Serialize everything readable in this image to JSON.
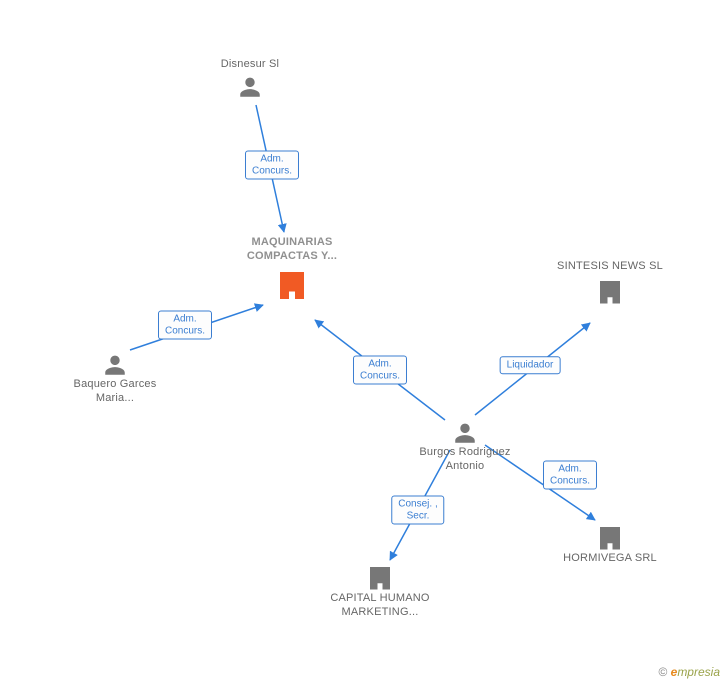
{
  "nodes": {
    "disnesur": {
      "label": "Disnesur Sl",
      "type": "person",
      "highlight": false
    },
    "maquinarias": {
      "label": "MAQUINARIAS\nCOMPACTAS\nY...",
      "type": "company",
      "highlight": true
    },
    "baquero": {
      "label": "Baquero\nGarces\nMaria...",
      "type": "person",
      "highlight": false
    },
    "burgos": {
      "label": "Burgos\nRodriguez\nAntonio",
      "type": "person",
      "highlight": false
    },
    "sintesis": {
      "label": "SINTESIS\nNEWS SL",
      "type": "company",
      "highlight": false
    },
    "hormivega": {
      "label": "HORMIVEGA SRL",
      "type": "company",
      "highlight": false
    },
    "capital": {
      "label": "CAPITAL\nHUMANO\nMARKETING...",
      "type": "company",
      "highlight": false
    }
  },
  "edges": [
    {
      "from": "disnesur",
      "to": "maquinarias",
      "role": "Adm.\nConcurs."
    },
    {
      "from": "baquero",
      "to": "maquinarias",
      "role": "Adm.\nConcurs."
    },
    {
      "from": "burgos",
      "to": "maquinarias",
      "role": "Adm.\nConcurs."
    },
    {
      "from": "burgos",
      "to": "sintesis",
      "role": "Liquidador"
    },
    {
      "from": "burgos",
      "to": "hormivega",
      "role": "Adm.\nConcurs."
    },
    {
      "from": "burgos",
      "to": "capital",
      "role": "Consej. ,\nSecr."
    }
  ],
  "copyright": {
    "symbol": "©",
    "brand_e": "e",
    "brand_rest": "mpresia"
  },
  "colors": {
    "edge": "#2f7fdc",
    "person_icon": "#777777",
    "company_icon": "#777777",
    "company_highlight": "#f15a24",
    "edge_label_border": "#3b7ed1",
    "edge_label_text": "#3b7ed1"
  }
}
